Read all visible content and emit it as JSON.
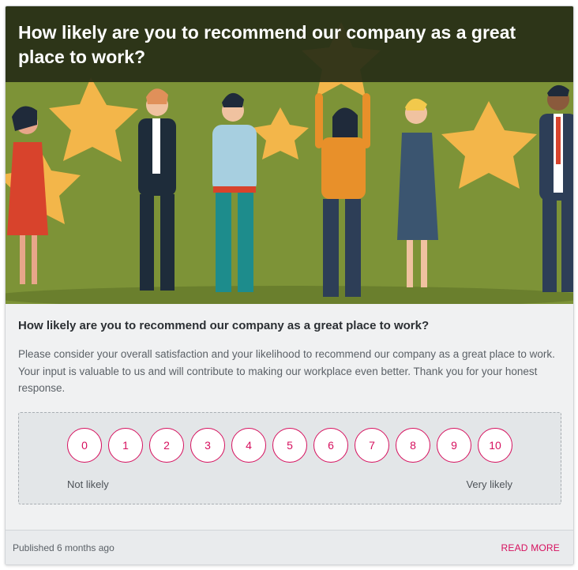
{
  "hero": {
    "title": "How likely are you to recommend our company as a great place to work?",
    "image": "illustration-people-holding-stars",
    "background_color": "#7d9337"
  },
  "question": {
    "title": "How likely are you to recommend our company as a great place to work?",
    "description": "Please consider your overall satisfaction and your likelihood to recommend our company as a great place to work. Your input is valuable to us and will contribute to making our workplace even better. Thank you for your honest response."
  },
  "scale": {
    "options": [
      "0",
      "1",
      "2",
      "3",
      "4",
      "5",
      "6",
      "7",
      "8",
      "9",
      "10"
    ],
    "min_label": "Not likely",
    "max_label": "Very likely",
    "accent_color": "#d6105e"
  },
  "footer": {
    "published": "Published 6 months ago",
    "read_more": "READ MORE"
  }
}
